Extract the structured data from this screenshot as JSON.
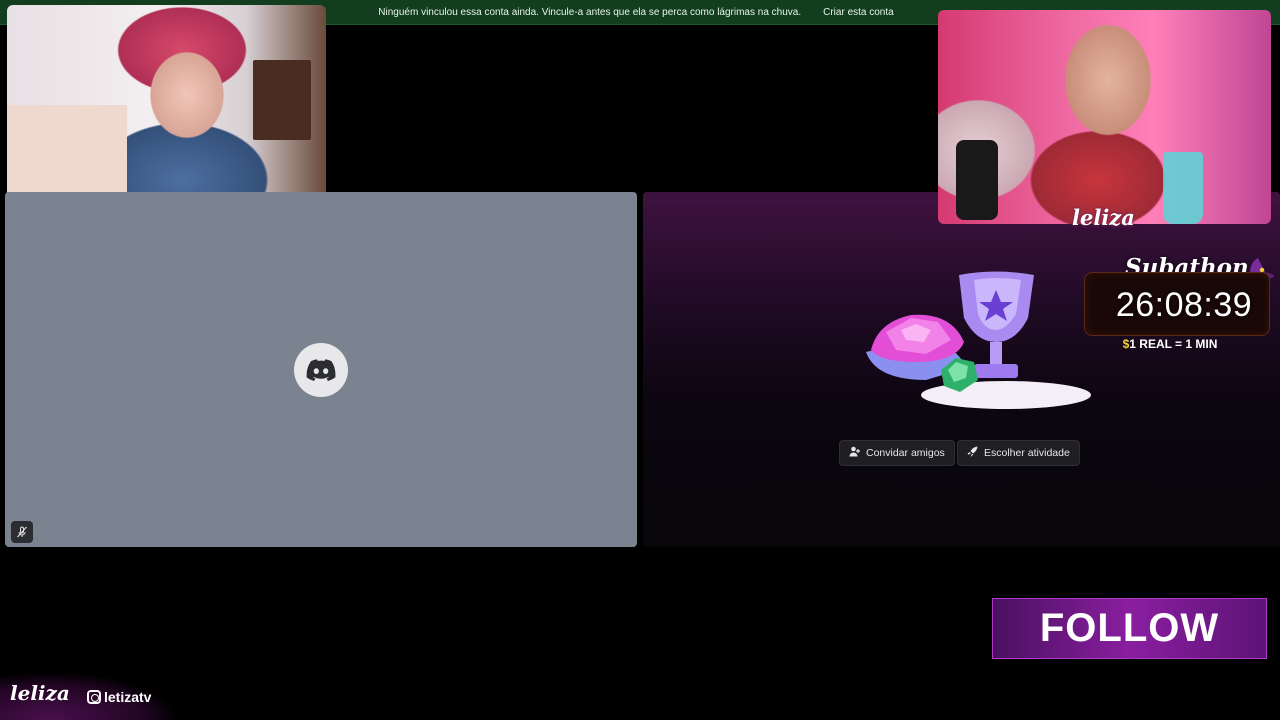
{
  "banner": {
    "message": "Ninguém vinculou essa conta ainda. Vincule-a antes que ela se perca como lágrimas na chuva.",
    "action_label": "Criar esta conta"
  },
  "activity": {
    "invite_label": "Convidar amigos",
    "choose_activity_label": "Escolher atividade"
  },
  "overlay": {
    "signature": "leliza",
    "subathon_title": "Subathon",
    "timer": "26:08:39",
    "rate_dollar": "$",
    "rate_text": "1 REAL = 1 MIN",
    "follow_label": "FOLLOW",
    "brand": "leliza",
    "instagram_handle": "letizatv"
  },
  "colors": {
    "banner_bg": "#123d1f",
    "tile_grey": "#7b8290",
    "follow_bg": "#8a1ea0",
    "accent_gold": "#f6d23a"
  },
  "icons": {
    "discord": "discord-logo-icon",
    "mute": "mic-muted-icon",
    "invite": "add-friend-icon",
    "activity": "rocket-icon",
    "instagram": "instagram-icon"
  }
}
